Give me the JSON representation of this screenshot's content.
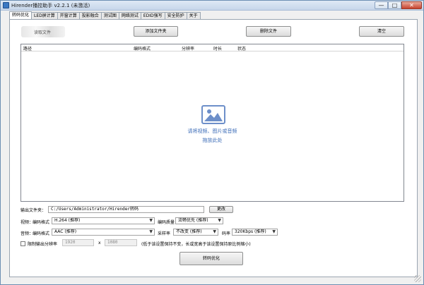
{
  "window": {
    "title": "Hirender播控助手 v2.2.1 (未激活)",
    "controls": {
      "minimize": "—",
      "maximize": "□",
      "close": "✕"
    }
  },
  "tabs": [
    {
      "label": "转码优化",
      "active": true
    },
    {
      "label": "LED屏计算"
    },
    {
      "label": "开窗计算"
    },
    {
      "label": "投影融合"
    },
    {
      "label": "测试图"
    },
    {
      "label": "网络测试"
    },
    {
      "label": "EDID强写"
    },
    {
      "label": "安全防护"
    },
    {
      "label": "关于"
    }
  ],
  "toolbar": {
    "logo_text": "读取文件",
    "add_folder": "添加文件夹",
    "delete_file": "删除文件",
    "clear": "清空"
  },
  "file_list": {
    "columns": [
      "路径",
      "编码格式",
      "分辨率",
      "时长",
      "状态"
    ],
    "placeholder_line1": "请将视频、图片或音频",
    "placeholder_line2": "拖放此处"
  },
  "output": {
    "folder_label": "输出文件夹：",
    "folder_path": "C:/Users/Administrator/Hirender转码",
    "change_button": "更改"
  },
  "video": {
    "row_label": "视频：",
    "codec_label": "编码格式",
    "codec_value": "H.264 (推荐)",
    "quality_label": "编码质量",
    "quality_value": "流畅优先 (推荐)"
  },
  "audio": {
    "row_label": "音频：",
    "codec_label": "编码格式",
    "codec_value": "AAC (推荐)",
    "samplerate_label": "采样率",
    "samplerate_value": "不改变 (推荐)",
    "bitrate_label": "码率",
    "bitrate_value": "320Kbps (推荐)"
  },
  "resolution_limit": {
    "checkbox_label": "限制输出分辨率",
    "width": "1920",
    "times": "x",
    "height": "1080",
    "note": "(低于该设置保持不变，长或宽高于该设置保持原比例缩小)"
  },
  "actions": {
    "transcode": "转码优化"
  },
  "colors": {
    "accent": "#3d6db8",
    "icon": "#6d8fc9",
    "close": "#c7432f"
  }
}
